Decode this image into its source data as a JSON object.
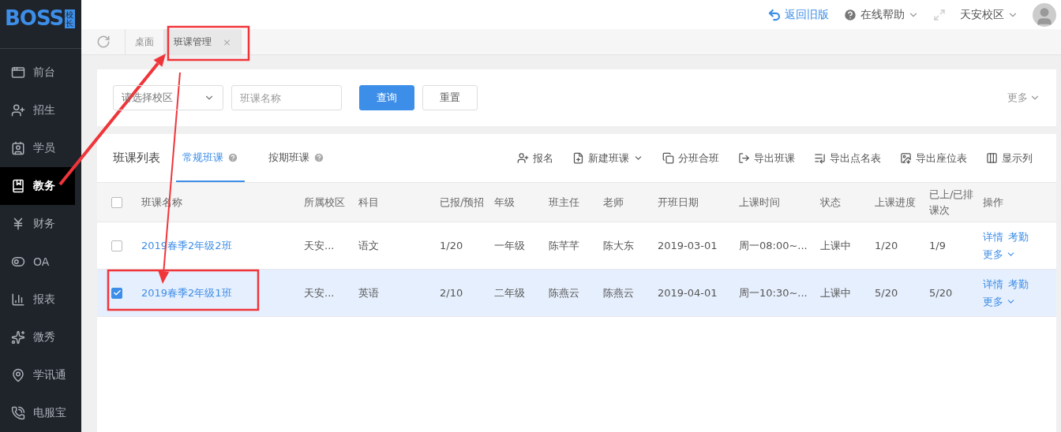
{
  "logo": {
    "text": "BOSS",
    "badge": "校长"
  },
  "topbar": {
    "back": "返回旧版",
    "help": "在线帮助",
    "campus": "天安校区"
  },
  "sidebar": {
    "items": [
      {
        "label": "前台",
        "selected": false
      },
      {
        "label": "招生",
        "selected": false
      },
      {
        "label": "学员",
        "selected": false
      },
      {
        "label": "教务",
        "selected": true
      },
      {
        "label": "财务",
        "selected": false
      },
      {
        "label": "OA",
        "selected": false
      },
      {
        "label": "报表",
        "selected": false
      },
      {
        "label": "微秀",
        "selected": false
      },
      {
        "label": "学讯通",
        "selected": false
      },
      {
        "label": "电服宝",
        "selected": false
      }
    ]
  },
  "tabs": [
    {
      "label": "桌面",
      "selected": false
    },
    {
      "label": "班课管理",
      "selected": true,
      "close": "×"
    }
  ],
  "filter": {
    "campus_placeholder": "请选择校区",
    "name_placeholder": "班课名称",
    "search": "查询",
    "reset": "重置",
    "more": "更多"
  },
  "list": {
    "title": "班课列表",
    "tabs": [
      {
        "label": "常规班课",
        "selected": true
      },
      {
        "label": "按期班课",
        "selected": false
      }
    ],
    "actions": [
      {
        "label": "报名",
        "caret": false
      },
      {
        "label": "新建班课",
        "caret": true
      },
      {
        "label": "分班合班",
        "caret": false
      },
      {
        "label": "导出班课",
        "caret": false
      },
      {
        "label": "导出点名表",
        "caret": false
      },
      {
        "label": "导出座位表",
        "caret": false
      },
      {
        "label": "显示列",
        "caret": false
      }
    ]
  },
  "table": {
    "columns": [
      "班课名称",
      "所属校区",
      "科目",
      "已报/预招",
      "年级",
      "班主任",
      "老师",
      "开班日期",
      "上课时间",
      "状态",
      "上课进度",
      "已上/已排课次",
      "操作"
    ],
    "all_checked": false,
    "rows": [
      {
        "selected": false,
        "cells": [
          "2019春季2年级2班",
          "天安...",
          "语文",
          "1/20",
          "一年级",
          "陈芊芊",
          "陈大东",
          "2019-03-01",
          "周一08:00~...",
          "上课中",
          "1/20",
          "1/9"
        ],
        "actions": [
          "详情",
          "考勤"
        ],
        "more": "更多"
      },
      {
        "selected": true,
        "cells": [
          "2019春季2年级1班",
          "天安...",
          "英语",
          "2/10",
          "二年级",
          "陈燕云",
          "陈燕云",
          "2019-04-01",
          "周一10:30~...",
          "上课中",
          "5/20",
          "5/20"
        ],
        "actions": [
          "详情",
          "考勤"
        ],
        "more": "更多"
      }
    ]
  }
}
